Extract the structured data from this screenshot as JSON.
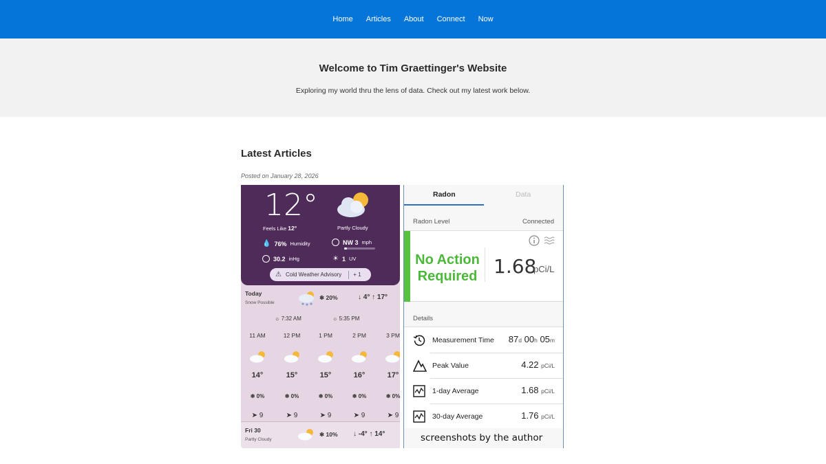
{
  "nav": {
    "items": [
      "Home",
      "Articles",
      "About",
      "Connect",
      "Now"
    ]
  },
  "hero": {
    "title": "Welcome to Tim Graettinger's Website",
    "subtitle": "Exploring my world thru the lens of data. Check out my latest work below."
  },
  "main": {
    "section_title": "Latest Articles",
    "posted": "Posted on January 28, 2026"
  },
  "weather": {
    "temp": "12°",
    "feels_label": "Feels Like",
    "feels_value": "12°",
    "condition": "Partly Cloudy",
    "humidity_value": "76%",
    "humidity_label": "Humidity",
    "wind_value": "NW 3",
    "wind_unit": "mph",
    "pressure_value": "30.2",
    "pressure_unit": "inHg",
    "uv_value": "1",
    "uv_label": "UV",
    "advisory": "Cold Weather Advisory",
    "advisory_more": "+ 1",
    "today_label": "Today",
    "today_sub": "Snow Possible",
    "today_precip": "❄ 20%",
    "today_range": "↓ 4° ↑ 17°",
    "sunrise": "7:32 AM",
    "sunset": "5:35 PM",
    "hours": [
      {
        "h": "11 AM",
        "t": "14°",
        "p": "❄ 0%",
        "w": "➤ 9"
      },
      {
        "h": "12 PM",
        "t": "15°",
        "p": "❄ 0%",
        "w": "➤ 9"
      },
      {
        "h": "1 PM",
        "t": "15°",
        "p": "❄ 0%",
        "w": "➤ 9"
      },
      {
        "h": "2 PM",
        "t": "16°",
        "p": "❄ 0%",
        "w": "➤ 9"
      },
      {
        "h": "3 PM",
        "t": "17°",
        "p": "❄ 0%",
        "w": "➤ 9"
      }
    ],
    "fri_label": "Fri 30",
    "fri_sub": "Partly Cloudy",
    "fri_precip": "❄ 10%",
    "fri_range": "↓ -4° ↑ 14°"
  },
  "radon": {
    "tab_active": "Radon",
    "tab_other": "Data",
    "level_label": "Radon Level",
    "connected": "Connected",
    "status_line1": "No Action",
    "status_line2": "Required",
    "value": "1.68",
    "unit": "pCi/L",
    "details_label": "Details",
    "measurement_time_label": "Measurement Time",
    "mt_d": "87",
    "mt_h": "00",
    "mt_m": "05",
    "peak_label": "Peak Value",
    "peak_value": "4.22",
    "avg1_label": "1-day Average",
    "avg1_value": "1.68",
    "avg30_label": "30-day Average",
    "avg30_value": "1.76",
    "caption": "screenshots by the author",
    "status_color": "#4cb83a"
  }
}
